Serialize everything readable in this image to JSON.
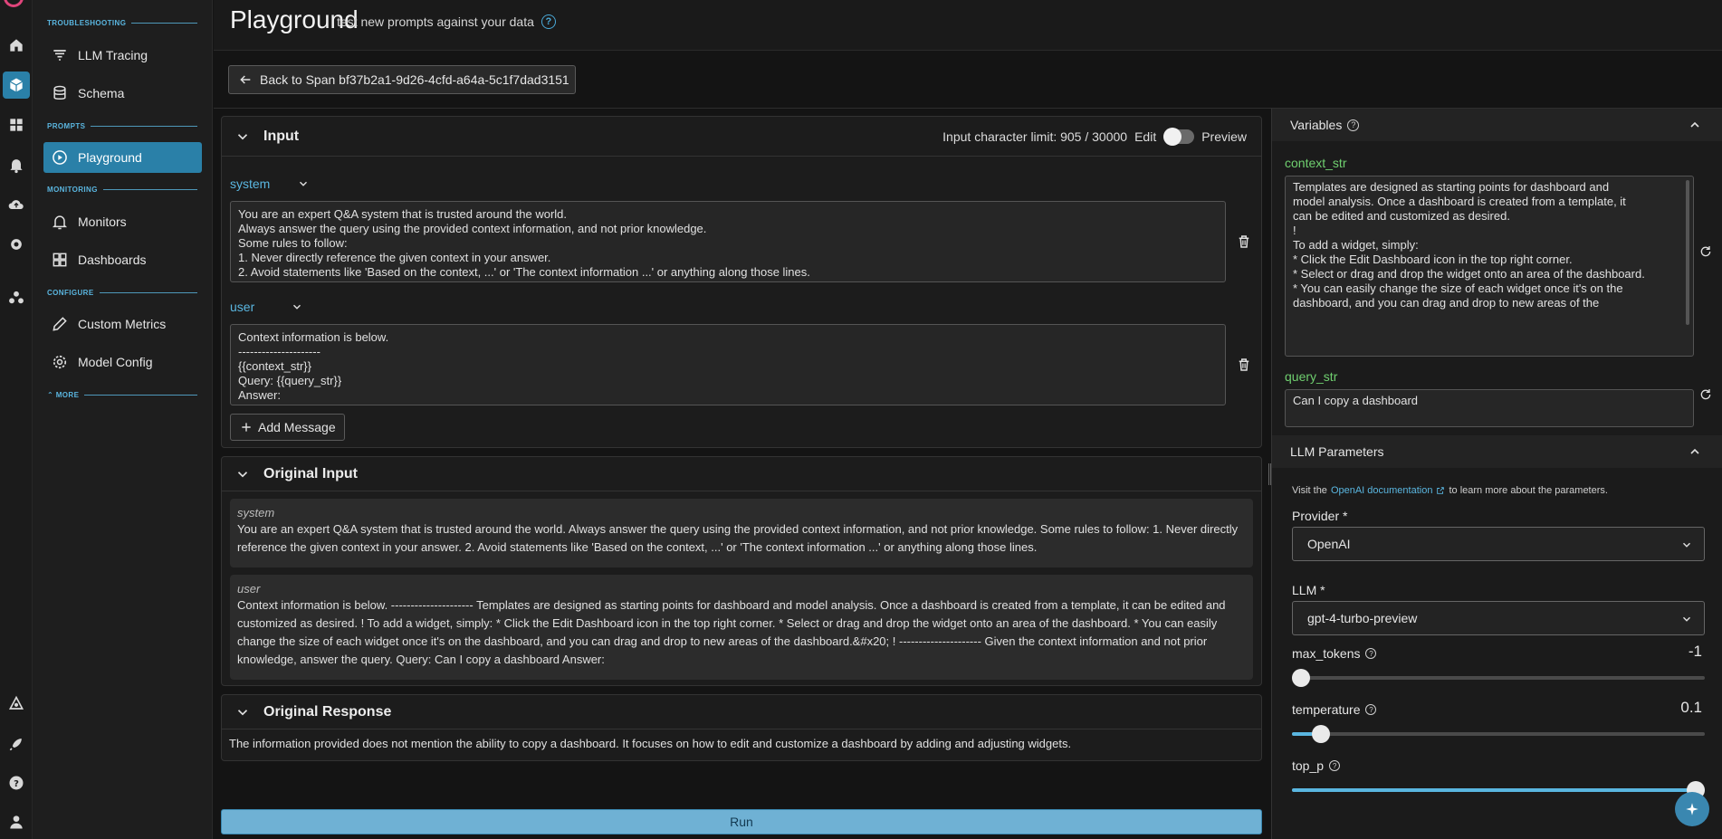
{
  "header": {
    "title": "Playground",
    "subtitle": "test new prompts against your data"
  },
  "sidebar": {
    "sections": {
      "troubleshooting": "TROUBLESHOOTING",
      "prompts": "PROMPTS",
      "monitoring": "MONITORING",
      "configure": "CONFIGURE",
      "more": "MORE"
    },
    "items": [
      {
        "label": "LLM Tracing"
      },
      {
        "label": "Schema"
      },
      {
        "label": "Playground"
      },
      {
        "label": "Monitors"
      },
      {
        "label": "Dashboards"
      },
      {
        "label": "Custom Metrics"
      },
      {
        "label": "Model Config"
      }
    ]
  },
  "back_button": {
    "label": "Back to Span bf37b2a1-9d26-4cfd-a64a-5c1f7dad3151"
  },
  "input_panel": {
    "title": "Input",
    "char_limit": "Input character limit: 905 / 30000",
    "edit_label": "Edit",
    "preview_label": "Preview",
    "messages": [
      {
        "role": "system",
        "lines": [
          "You are an expert Q&A system that is trusted around the world.",
          "Always answer the query using the provided context information, and not prior knowledge.",
          "Some rules to follow:",
          "1. Never directly reference the given context in your answer.",
          "2. Avoid statements like 'Based on the context, ...' or 'The context information ...' or anything along those lines."
        ]
      },
      {
        "role": "user",
        "lines": [
          "Context information is below.",
          "---------------------",
          "{{context_str}}",
          "Query: {{query_str}}",
          "Answer:"
        ]
      }
    ],
    "add_message_label": "Add Message"
  },
  "original_input": {
    "title": "Original Input",
    "messages": [
      {
        "role": "system",
        "text": "You are an expert Q&A system that is trusted around the world. Always answer the query using the provided context information, and not prior knowledge. Some rules to follow: 1. Never directly reference the given context in your answer. 2. Avoid statements like 'Based on the context, ...' or 'The context information ...' or anything along those lines."
      },
      {
        "role": "user",
        "text": "Context information is below. --------------------- Templates are designed as starting points for dashboard and model analysis. Once a dashboard is created from a template, it can be edited and customized as desired. ! To add a widget, simply: * Click the Edit Dashboard icon in the top right corner. * Select or drag and drop the widget onto an area of the dashboard. * You can easily change the size of each widget once it's on the dashboard, and you can drag and drop to new areas of the dashboard.&#x20; ! --------------------- Given the context information and not prior knowledge, answer the query. Query: Can I copy a dashboard Answer:"
      }
    ]
  },
  "original_response": {
    "title": "Original Response",
    "text": "The information provided does not mention the ability to copy a dashboard. It focuses on how to edit and customize a dashboard by adding and adjusting widgets."
  },
  "run_label": "Run",
  "variables": {
    "title": "Variables",
    "items": [
      {
        "name": "context_str",
        "lines": [
          "Templates are designed as starting points for dashboard and",
          "model analysis. Once a dashboard is created from a template, it",
          "can be edited and customized as desired.",
          "",
          "!",
          "",
          "To add a widget, simply:",
          "",
          "* Click the Edit Dashboard icon in the top right corner.",
          "* Select or drag and drop the widget onto an area of the dashboard.",
          "* You can easily change the size of each widget once it's on the",
          "dashboard, and you can drag and drop to new areas of the"
        ]
      },
      {
        "name": "query_str",
        "lines": [
          "Can I copy a dashboard"
        ]
      }
    ]
  },
  "llm_params": {
    "title": "LLM Parameters",
    "note_prefix": "Visit the",
    "note_link": "OpenAI documentation",
    "note_suffix": "to learn more about the parameters.",
    "provider_label": "Provider *",
    "provider_value": "OpenAI",
    "llm_label": "LLM *",
    "llm_value": "gpt-4-turbo-preview",
    "max_tokens_label": "max_tokens",
    "max_tokens_value": "-1",
    "max_tokens_fraction": 0.0,
    "temperature_label": "temperature",
    "temperature_value": "0.1",
    "temperature_fraction": 0.05,
    "top_p_label": "top_p",
    "top_p_fraction": 1.0
  },
  "colors": {
    "accent": "#2a80a8",
    "link": "#5ab6e0",
    "variable": "#6fcf6f",
    "run": "#6fb1d4"
  }
}
